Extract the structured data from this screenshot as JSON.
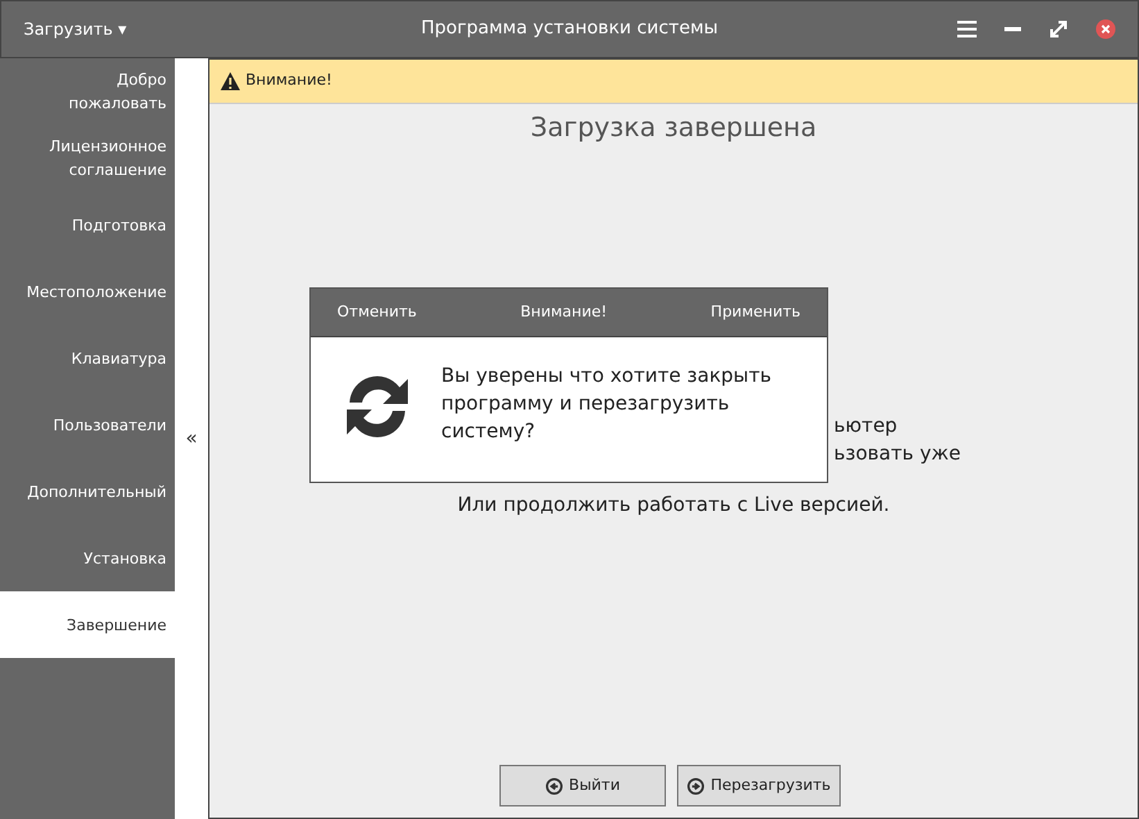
{
  "title_bar": {
    "menu": "Загрузить ▾",
    "title": "Программа установки системы"
  },
  "sidebar": {
    "items": [
      {
        "label": "Добро пожаловать",
        "selected": false
      },
      {
        "label": "Лицензионное соглашение",
        "selected": false
      },
      {
        "label": "Подготовка",
        "selected": false
      },
      {
        "label": "Местоположение",
        "selected": false
      },
      {
        "label": "Клавиатура",
        "selected": false
      },
      {
        "label": "Пользователи",
        "selected": false
      },
      {
        "label": "Дополнительный",
        "selected": false
      },
      {
        "label": "Установка",
        "selected": false
      },
      {
        "label": "Завершение",
        "selected": true
      }
    ],
    "collapse": "«"
  },
  "alert": {
    "text": "Внимание!"
  },
  "content": {
    "heading": "Загрузка завершена",
    "body_fragments": [
      "ьютер",
      "ьзовать уже"
    ],
    "body_last": "Или продолжить работать с Live версией."
  },
  "buttons": [
    {
      "label": "Выйти",
      "kind": "back"
    },
    {
      "label": "Перезагрузить",
      "kind": "forward"
    }
  ],
  "dialog": {
    "cancel": "Отменить",
    "title": "Внимание!",
    "apply": "Применить",
    "message": "Вы уверены что хотите закрыть программу и перезагрузить систему?"
  }
}
